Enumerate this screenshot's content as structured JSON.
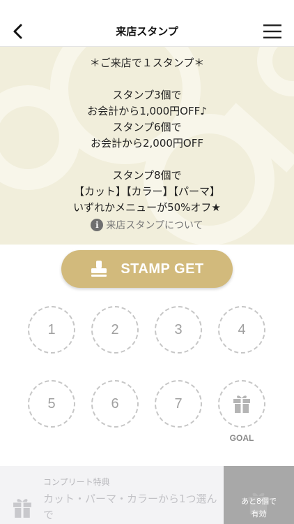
{
  "header": {
    "title": "来店スタンプ"
  },
  "banner": {
    "lines": [
      "＊ご来店で１スタンプ＊",
      "",
      "スタンプ3個で",
      "お会計から1,000円OFF♪",
      "スタンプ6個で",
      "お会計から2,000円OFF",
      "",
      "スタンプ8個で",
      "【カット】【カラー】【パーマ】",
      "いずれかメニューが50%オフ★"
    ],
    "info_link": "来店スタンプについて",
    "info_icon": "i"
  },
  "stamp_button": {
    "label": "STAMP GET",
    "icon": "stamp-icon"
  },
  "stamps": {
    "slots": [
      "1",
      "2",
      "3",
      "4",
      "5",
      "6",
      "7"
    ],
    "goal_label": "GOAL",
    "goal_icon": "gift-icon"
  },
  "complete": {
    "caption": "コンプリート特典",
    "description": "カット・パーマ・カラーから1つ選んで",
    "remaining_line1": "あと8個で",
    "remaining_line2": "有効"
  },
  "colors": {
    "accent_gold": "#d2ba7c",
    "banner_bg": "#f1eedb",
    "stamp_border": "#c6c6c6",
    "remain_bg": "#a8a8a8"
  }
}
